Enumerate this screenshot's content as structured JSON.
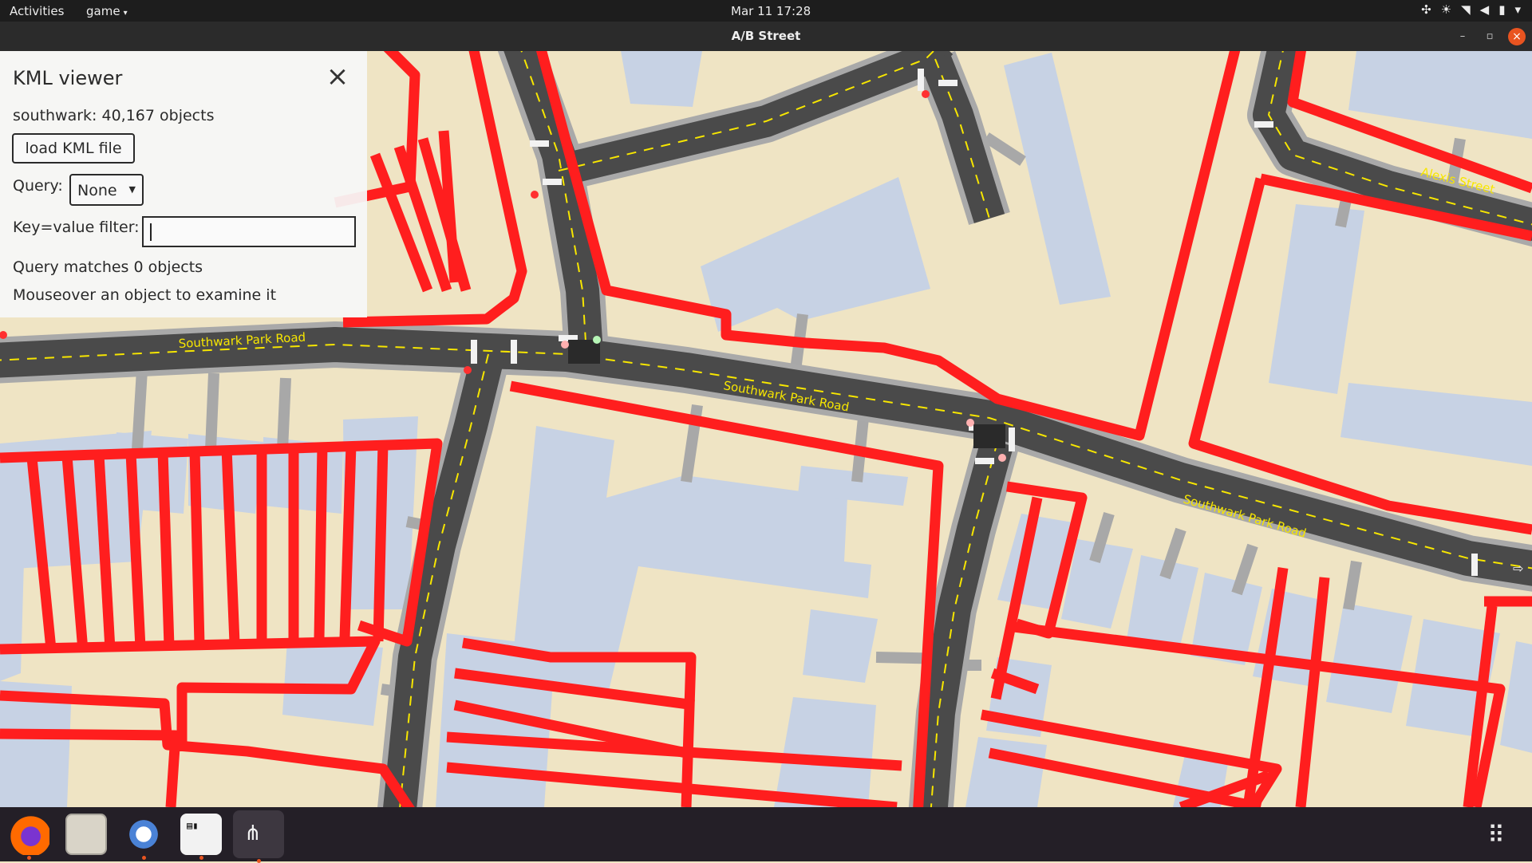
{
  "topbar": {
    "activities": "Activities",
    "app_menu": "game",
    "clock": "Mar 11  17:28",
    "tray_icons": [
      "dropbox-icon",
      "brightness-icon",
      "wifi-icon",
      "volume-icon",
      "battery-icon",
      "system-menu-icon"
    ]
  },
  "window": {
    "title": "A/B Street",
    "controls": [
      "minimize-icon",
      "maximize-icon",
      "close-icon"
    ]
  },
  "panel": {
    "title": "KML viewer",
    "object_count": "southwark: 40,167 objects",
    "load_button": "load KML file",
    "query_label": "Query:",
    "query_value": "None",
    "filter_label": "Key=value filter:",
    "filter_value": "",
    "matches": "Query matches 0 objects",
    "hint": "Mouseover an object to examine it"
  },
  "map": {
    "road_labels": [
      "Southwark Park Road",
      "Southwark Park Road",
      "Southwark Park Road",
      "Alexis Street"
    ],
    "colors": {
      "ground": "#efe4c4",
      "building": "#c7d2e4",
      "road": "#4a4a4a",
      "sidewalk": "#a8a8a8",
      "kml_outline": "#ff1e1e",
      "lane_marking": "#f7e600"
    }
  },
  "dock": {
    "apps": [
      "firefox-icon",
      "files-icon",
      "chromium-icon",
      "terminal-icon",
      "abstreet-icon"
    ],
    "apps_grid_icon": "show-applications-icon"
  }
}
